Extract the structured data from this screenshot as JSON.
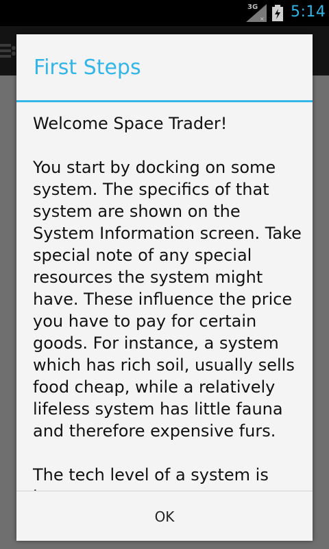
{
  "status_bar": {
    "network_label": "3G",
    "time": "5:14",
    "icons": [
      "signal-icon",
      "battery-charging-icon"
    ],
    "time_color": "#33b5e5"
  },
  "app": {
    "menu_icon": "hamburger-menu-icon"
  },
  "dialog": {
    "title": "First Steps",
    "accent_color": "#33b5e5",
    "paragraphs": [
      "Welcome Space Trader!",
      "You start by docking on some system. The specifics of that system are shown on the System Information screen. Take special note of any special resources the system might have. These influence the price you have to pay for certain goods. For instance, a system which has rich soil, usually sells food cheap, while a relatively lifeless system has little fauna and therefore expensive furs.",
      "The tech level of a system is important too"
    ],
    "button_label": "OK"
  }
}
